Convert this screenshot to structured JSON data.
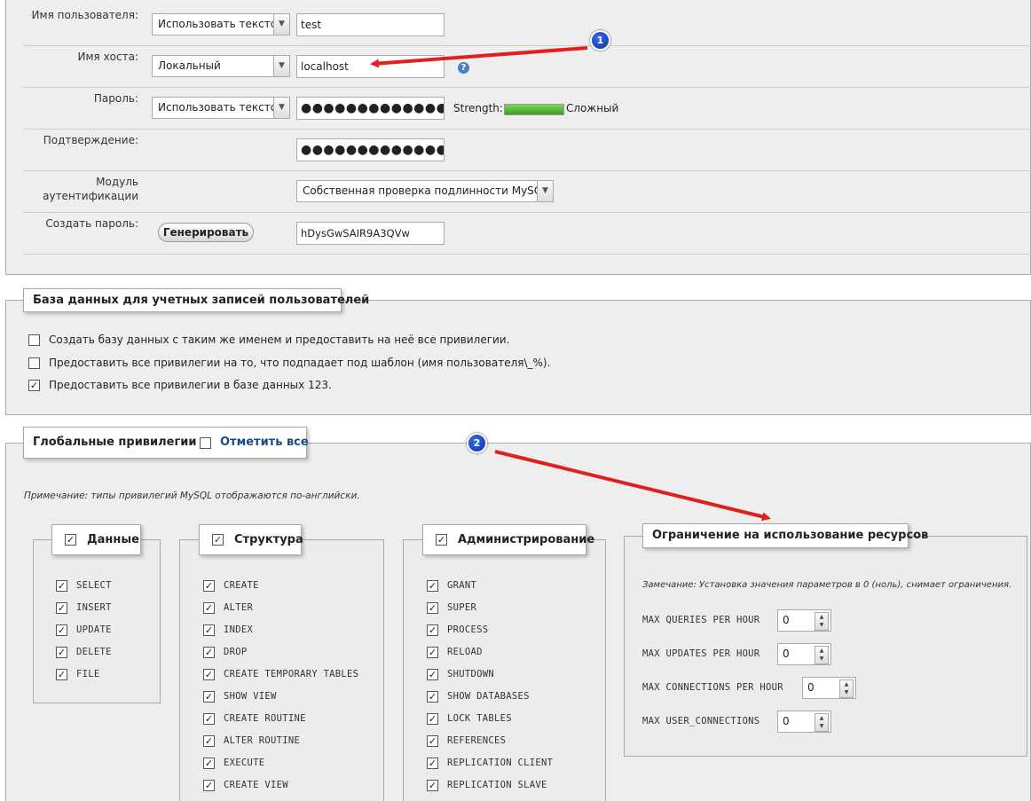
{
  "login": {
    "username_label": "Имя пользователя:",
    "username_mode": "Использовать текстов",
    "username_value": "test",
    "host_label": "Имя хоста:",
    "host_mode": "Локальный",
    "host_value": "localhost",
    "password_label": "Пароль:",
    "password_mode": "Использовать текстов",
    "password_value": "●●●●●●●●●●●●●●●●",
    "strength_label": "Strength:",
    "strength_text": "Сложный",
    "strength_level": 1.0,
    "confirm_label": "Подтверждение:",
    "confirm_value": "●●●●●●●●●●●●●●●●",
    "auth_label_line1": "Модуль",
    "auth_label_line2": "аутентификации",
    "auth_value": "Собственная проверка подлинности MySQL",
    "gen_label": "Создать пароль:",
    "gen_button": "Генерировать",
    "gen_value": "hDysGwSAIR9A3QVw"
  },
  "database": {
    "legend": "База данных для учетных записей пользователей",
    "options": [
      {
        "label": "Создать базу данных с таким же именем и предоставить на неё все привилегии.",
        "checked": false
      },
      {
        "label": "Предоставить все привилегии на то, что подпадает под шаблон (имя пользователя\\_%).",
        "checked": false
      },
      {
        "label": "Предоставить все привилегии в базе данных 123.",
        "checked": true
      }
    ]
  },
  "global": {
    "legend": "Глобальные привилегии",
    "check_all": "Отметить все",
    "note": "Примечание: типы привилегий MySQL отображаются по-английски."
  },
  "groups": {
    "data": {
      "legend": "Данные",
      "items": [
        "SELECT",
        "INSERT",
        "UPDATE",
        "DELETE",
        "FILE"
      ]
    },
    "structure": {
      "legend": "Структура",
      "items": [
        "CREATE",
        "ALTER",
        "INDEX",
        "DROP",
        "CREATE TEMPORARY TABLES",
        "SHOW VIEW",
        "CREATE ROUTINE",
        "ALTER ROUTINE",
        "EXECUTE",
        "CREATE VIEW"
      ]
    },
    "admin": {
      "legend": "Администрирование",
      "items": [
        "GRANT",
        "SUPER",
        "PROCESS",
        "RELOAD",
        "SHUTDOWN",
        "SHOW DATABASES",
        "LOCK TABLES",
        "REFERENCES",
        "REPLICATION CLIENT",
        "REPLICATION SLAVE"
      ]
    }
  },
  "limits": {
    "legend": "Ограничение на использование ресурсов",
    "note": "Замечание: Установка значения параметров в 0 (ноль), снимает ограничения.",
    "rows": [
      {
        "label": "MAX QUERIES PER HOUR",
        "value": "0"
      },
      {
        "label": "MAX UPDATES PER HOUR",
        "value": "0"
      },
      {
        "label": "MAX CONNECTIONS PER HOUR",
        "value": "0"
      },
      {
        "label": "MAX USER_CONNECTIONS",
        "value": "0"
      }
    ]
  },
  "annotations": {
    "badge1": "1",
    "badge2": "2"
  },
  "icons": {
    "help": "help-icon",
    "check": "checkmark-icon",
    "dropdown": "chevron-down-icon"
  },
  "colors": {
    "panel": "#eeeeee",
    "border": "#aaaaaa",
    "link": "#1a4a8a",
    "arrow": "#e02020",
    "badge": "#1a3fbf",
    "strength": "#4caf2a"
  }
}
